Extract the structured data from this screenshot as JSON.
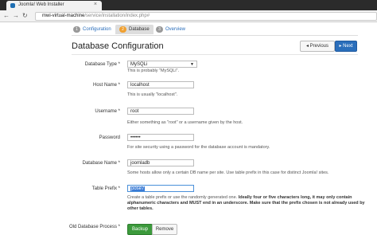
{
  "browser": {
    "tab_title": "Joomla! Web Installer",
    "url_host": "mwi-virtual-machine",
    "url_path": "/service/installation/index.php#"
  },
  "steps": [
    {
      "num": "1",
      "label": "Configuration"
    },
    {
      "num": "2",
      "label": "Database"
    },
    {
      "num": "3",
      "label": "Overview"
    }
  ],
  "page_title": "Database Configuration",
  "buttons": {
    "previous": "◂ Previous",
    "next": "▸ Next",
    "backup": "Backup",
    "remove": "Remove"
  },
  "form": {
    "db_type": {
      "label": "Database Type *",
      "value": "MySQLi",
      "help": "This is probably \"MySQLi\"."
    },
    "host": {
      "label": "Host Name *",
      "value": "localhost",
      "help": "This is usually \"localhost\"."
    },
    "username": {
      "label": "Username *",
      "value": "root",
      "help": "Either something as \"root\" or a username given by the host."
    },
    "password": {
      "label": "Password",
      "value": "••••••",
      "help": "For site security using a password for the database account is mandatory."
    },
    "db_name": {
      "label": "Database Name *",
      "value": "joomladb",
      "help": "Some hosts allow only a certain DB name per site. Use table prefix in this case for distinct Joomla! sites."
    },
    "prefix": {
      "label": "Table Prefix *",
      "value": "pose7",
      "help_normal": "Create a table prefix or use the randomly generated one. ",
      "help_bold": "Ideally four or five characters long, it may only contain alphanumeric characters and MUST end in an underscore. Make sure that the prefix chosen is not already used by other tables."
    },
    "old_db": {
      "label": "Old Database Process *"
    }
  }
}
